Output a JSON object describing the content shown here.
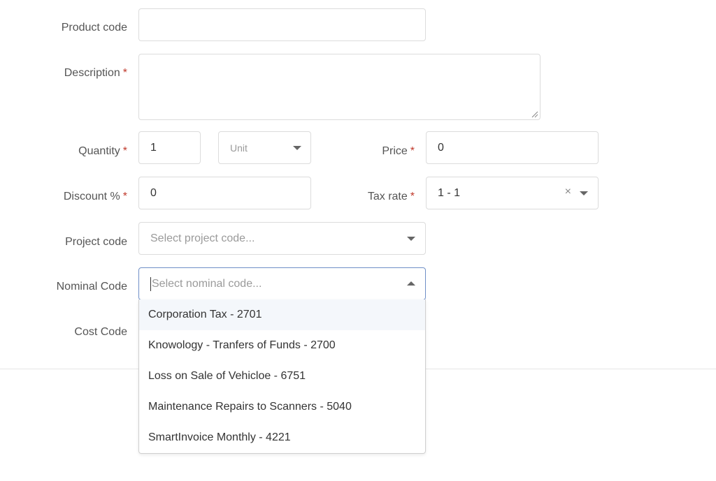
{
  "form": {
    "product_code": {
      "label": "Product code",
      "value": ""
    },
    "description": {
      "label": "Description",
      "required_mark": "*",
      "value": ""
    },
    "quantity": {
      "label": "Quantity",
      "required_mark": "*",
      "value": "1"
    },
    "unit": {
      "placeholder": "Unit"
    },
    "price": {
      "label": "Price",
      "required_mark": "*",
      "value": "0"
    },
    "discount": {
      "label": "Discount %",
      "required_mark": "*",
      "value": "0"
    },
    "tax_rate": {
      "label": "Tax rate",
      "required_mark": "*",
      "value": "1 - 1",
      "clear_glyph": "×"
    },
    "project_code": {
      "label": "Project code",
      "placeholder": "Select project code..."
    },
    "nominal_code": {
      "label": "Nominal Code",
      "placeholder": "Select nominal code...",
      "options": [
        "Corporation Tax - 2701",
        "Knowology - Tranfers of Funds - 2700",
        "Loss on Sale of Vehicloe - 6751",
        "Maintenance Repairs to Scanners - 5040",
        "SmartInvoice Monthly - 4221"
      ]
    },
    "cost_code": {
      "label": "Cost Code"
    }
  },
  "colors": {
    "required": "#c0392b",
    "focus_border": "#6f8fc7",
    "highlight": "#f4f7fb"
  },
  "icons": {
    "dropdown": "chevron-down-icon",
    "dropdown_open": "chevron-up-icon",
    "clear": "clear-icon",
    "resize": "resize-handle-icon"
  }
}
